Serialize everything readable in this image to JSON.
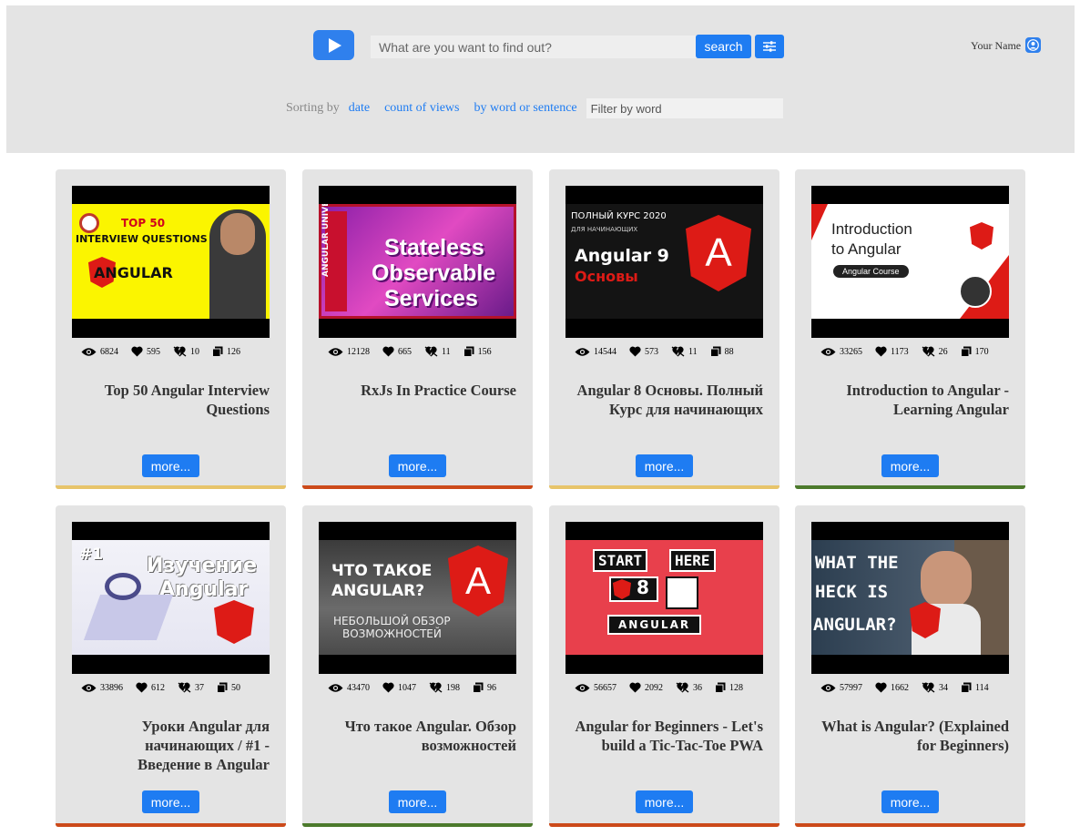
{
  "header": {
    "search_placeholder": "What are you want to find out?",
    "search_label": "search",
    "user_name": "Your Name",
    "sorting_label": "Sorting by",
    "sort_links": [
      "date",
      "count of views",
      "by word or sentence"
    ],
    "filter_placeholder": "Filter by word",
    "brand_color": "#2f80ed"
  },
  "cards": [
    {
      "title": "Top 50 Angular Interview Questions",
      "views": "6824",
      "likes": "595",
      "dislikes": "10",
      "comments": "126",
      "bar_color": "#e7c46a",
      "more": "more...",
      "thumb": {
        "lines": [
          "TOP 50",
          "INTERVIEW QUESTIONS",
          "ANGULAR"
        ]
      }
    },
    {
      "title": "RxJs In Practice Course",
      "views": "12128",
      "likes": "665",
      "dislikes": "11",
      "comments": "156",
      "bar_color": "#cc4a1a",
      "more": "more...",
      "thumb": {
        "lines": [
          "ANGULAR UNIVERSITY",
          "Stateless",
          "Observable",
          "Services"
        ]
      }
    },
    {
      "title": "Angular 8 Основы. Полный Курс для начинающих",
      "views": "14544",
      "likes": "573",
      "dislikes": "11",
      "comments": "88",
      "bar_color": "#e7c46a",
      "more": "more...",
      "thumb": {
        "lines": [
          "ПОЛНЫЙ КУРС 2020",
          "ДЛЯ НАЧИНАЮЩИХ",
          "Angular 9",
          "Основы"
        ]
      }
    },
    {
      "title": "Introduction to Angular - Learning Angular",
      "views": "33265",
      "likes": "1173",
      "dislikes": "26",
      "comments": "170",
      "bar_color": "#4c7a2c",
      "more": "more...",
      "thumb": {
        "lines": [
          "Introduction",
          "to Angular",
          "Angular Course"
        ]
      }
    },
    {
      "title": "Уроки Angular для начинающих / #1 - Введение в Angular",
      "views": "33896",
      "likes": "612",
      "dislikes": "37",
      "comments": "50",
      "bar_color": "#cc4a1a",
      "more": "more...",
      "thumb": {
        "lines": [
          "#1",
          "Изучение",
          "Angular"
        ]
      }
    },
    {
      "title": "Что такое Angular. Обзор возможностей",
      "views": "43470",
      "likes": "1047",
      "dislikes": "198",
      "comments": "96",
      "bar_color": "#4c7a2c",
      "more": "more...",
      "thumb": {
        "lines": [
          "ЧТО ТАКОЕ",
          "ANGULAR?",
          "НЕБОЛЬШОЙ ОБЗОР",
          "ВОЗМОЖНОСТЕЙ"
        ]
      }
    },
    {
      "title": "Angular for Beginners - Let's build a Tic-Tac-Toe PWA",
      "views": "56657",
      "likes": "2092",
      "dislikes": "36",
      "comments": "128",
      "bar_color": "#cc4a1a",
      "more": "more...",
      "thumb": {
        "lines": [
          "START",
          "HERE",
          "8",
          "ANGULAR"
        ]
      }
    },
    {
      "title": "What is Angular? (Explained for Beginners)",
      "views": "57997",
      "likes": "1662",
      "dislikes": "34",
      "comments": "114",
      "bar_color": "#cc4a1a",
      "more": "more...",
      "thumb": {
        "lines": [
          "WHAT THE",
          "HECK IS",
          "ANGULAR?"
        ]
      }
    }
  ]
}
